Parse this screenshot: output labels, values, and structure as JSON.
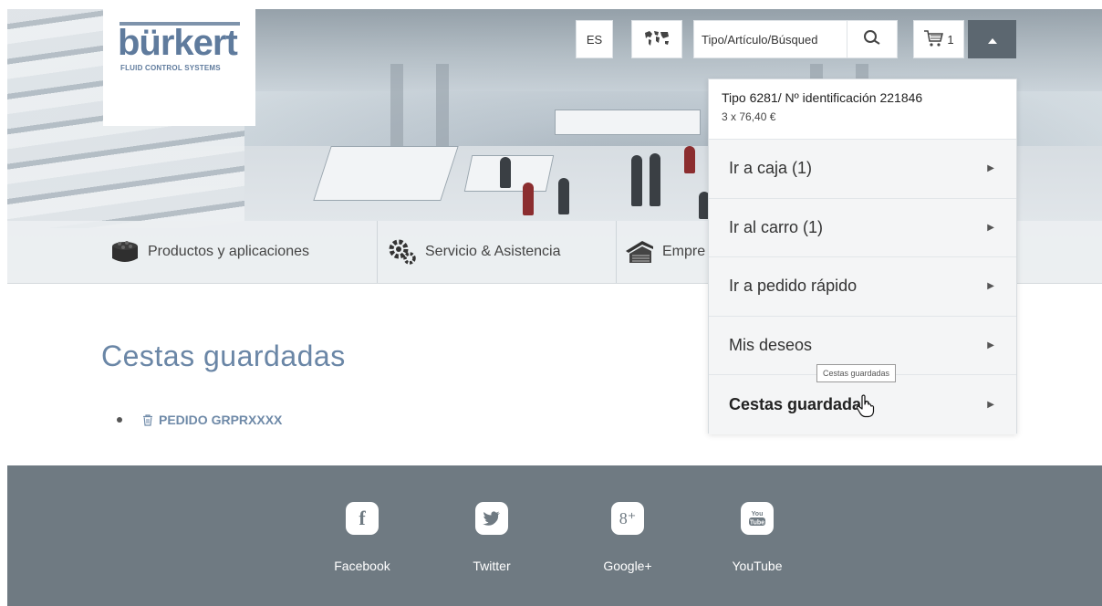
{
  "header": {
    "logo": {
      "brand": "bürkert",
      "tagline": "FLUID CONTROL SYSTEMS"
    },
    "toolbar": {
      "language": "ES",
      "region_icon": "world-map-icon",
      "search_value": "Tipo/Artículo/Búsqued",
      "search_icon": "search-icon",
      "cart_count": "1",
      "cart_icon": "cart-icon",
      "toggle_icon": "caret-up-icon"
    }
  },
  "nav": {
    "items": [
      {
        "label": "Productos y aplicaciones",
        "icon": "stack-box-icon"
      },
      {
        "label": "Servicio & Asistencia",
        "icon": "gears-icon"
      },
      {
        "label": "Empre",
        "icon": "building-icon"
      }
    ]
  },
  "main": {
    "title": "Cestas guardadas",
    "baskets": [
      {
        "label": "PEDIDO GRPRXXXX",
        "icon": "trash-icon"
      }
    ]
  },
  "cart_dropdown": {
    "product": "Tipo 6281/ Nº identificación 221846",
    "price": "3 x 76,40 €",
    "items": [
      {
        "label": "Ir a caja (1)"
      },
      {
        "label": "Ir al carro (1)"
      },
      {
        "label": "Ir a pedido rápido"
      },
      {
        "label": "Mis deseos"
      },
      {
        "label": "Cestas guardadas"
      }
    ],
    "tooltip": "Cestas guardadas"
  },
  "footer": {
    "social": [
      {
        "label": "Facebook",
        "icon": "facebook-icon",
        "glyph": "f"
      },
      {
        "label": "Twitter",
        "icon": "twitter-icon",
        "glyph": ""
      },
      {
        "label": "Google+",
        "icon": "google-plus-icon",
        "glyph": "8⁺"
      },
      {
        "label": "YouTube",
        "icon": "youtube-icon",
        "glyph": ""
      }
    ]
  },
  "colors": {
    "brand": "#5f7b9d",
    "title": "#6a86a6",
    "footer_bg": "#6f7a82",
    "toggle_bg": "#5c6770"
  }
}
